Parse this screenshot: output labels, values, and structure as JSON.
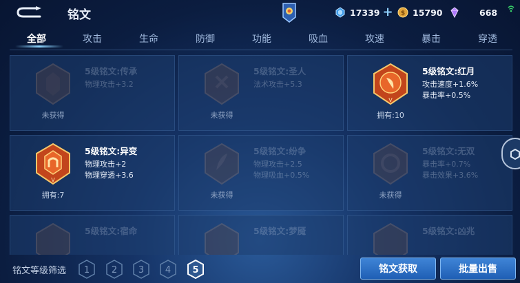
{
  "header": {
    "title": "铭文",
    "resources": [
      {
        "icon": "blue-gem-icon",
        "value": "17339",
        "add": "+"
      },
      {
        "icon": "gold-coin-icon",
        "value": "15790"
      },
      {
        "icon": "purple-crystal-icon",
        "value": "668"
      }
    ]
  },
  "tabs": [
    "全部",
    "攻击",
    "生命",
    "防御",
    "功能",
    "吸血",
    "攻速",
    "暴击",
    "穿透"
  ],
  "cards": [
    {
      "name": "5级铭文:传承",
      "stats": [
        "物理攻击+3.2"
      ],
      "footer": "未获得",
      "owned": false
    },
    {
      "name": "5级铭文:圣人",
      "stats": [
        "法术攻击+5.3"
      ],
      "footer": "未获得",
      "owned": false
    },
    {
      "name": "5级铭文:红月",
      "stats": [
        "攻击速度+1.6%",
        "暴击率+0.5%"
      ],
      "footer": "拥有:10",
      "owned": true
    },
    {
      "name": "5级铭文:异变",
      "stats": [
        "物理攻击+2",
        "物理穿透+3.6"
      ],
      "footer": "拥有:7",
      "owned": true
    },
    {
      "name": "5级铭文:纷争",
      "stats": [
        "物理攻击+2.5",
        "物理吸血+0.5%"
      ],
      "footer": "未获得",
      "owned": false
    },
    {
      "name": "5级铭文:无双",
      "stats": [
        "暴击率+0.7%",
        "暴击效果+3.6%"
      ],
      "footer": "未获得",
      "owned": false
    },
    {
      "name": "5级铭文:宿命",
      "stats": [],
      "footer": "",
      "owned": false
    },
    {
      "name": "5级铭文:梦魇",
      "stats": [],
      "footer": "",
      "owned": false
    },
    {
      "name": "5级铭文:凶兆",
      "stats": [],
      "footer": "",
      "owned": false
    }
  ],
  "filter": {
    "label": "铭文等级筛选",
    "levels": [
      "1",
      "2",
      "3",
      "4",
      "5"
    ],
    "selected": "5"
  },
  "buttons": {
    "acquire": "铭文获取",
    "bulk_sell": "批量出售"
  },
  "colors": {
    "accent": "#8cd4ff",
    "owned_emblem": "#e8662a",
    "button": "#2a6fc6"
  }
}
